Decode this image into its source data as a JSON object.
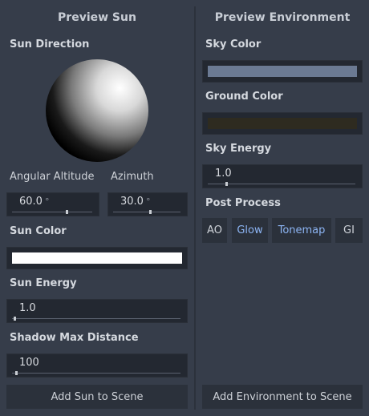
{
  "sun": {
    "title": "Preview Sun",
    "direction_label": "Sun Direction",
    "altitude_label": "Angular Altitude",
    "azimuth_label": "Azimuth",
    "altitude_value": "60.0",
    "azimuth_value": "30.0",
    "degree_unit": "°",
    "altitude_fraction": 0.67,
    "azimuth_fraction": 0.54,
    "color_label": "Sun Color",
    "color": "#ffffff",
    "energy_label": "Sun Energy",
    "energy_value": "1.0",
    "shadow_label": "Shadow Max Distance",
    "shadow_value": "100",
    "add_button": "Add Sun to Scene"
  },
  "environment": {
    "title": "Preview Environment",
    "sky_color_label": "Sky Color",
    "sky_color": "#6b7a93",
    "ground_color_label": "Ground Color",
    "ground_color": "#2e2b20",
    "sky_energy_label": "Sky Energy",
    "sky_energy_value": "1.0",
    "post_process_label": "Post Process",
    "post_buttons": [
      {
        "label": "AO",
        "active": false
      },
      {
        "label": "Glow",
        "active": true
      },
      {
        "label": "Tonemap",
        "active": true
      },
      {
        "label": "GI",
        "active": false
      }
    ],
    "add_button": "Add Environment to Scene"
  }
}
